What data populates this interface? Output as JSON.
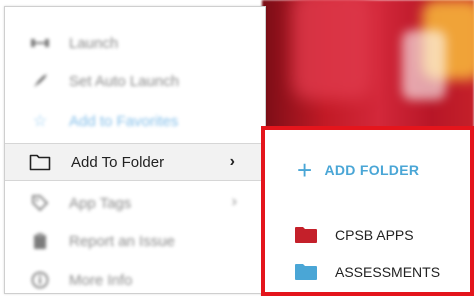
{
  "context_menu": {
    "items": [
      {
        "label": "Launch",
        "icon": "launch-icon"
      },
      {
        "label": "Set Auto Launch",
        "icon": "rocket-icon"
      },
      {
        "label": "Add to Favorites",
        "icon": "star-icon"
      },
      {
        "label": "Add To Folder",
        "icon": "folder-icon"
      },
      {
        "label": "App Tags",
        "icon": "tag-icon"
      },
      {
        "label": "Report an Issue",
        "icon": "report-icon"
      },
      {
        "label": "More Info",
        "icon": "info-icon"
      }
    ]
  },
  "submenu": {
    "add_folder_label": "ADD FOLDER",
    "folders": [
      {
        "label": "CPSB APPS",
        "color": "#c4202a"
      },
      {
        "label": "ASSESSMENTS",
        "color": "#4aa6d6"
      }
    ]
  },
  "colors": {
    "highlight_border": "#e4151c",
    "accent": "#4aa6d6"
  }
}
